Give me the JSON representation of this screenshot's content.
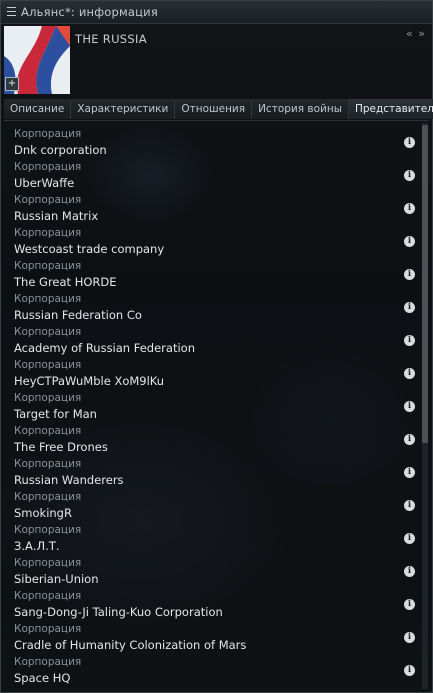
{
  "window": {
    "title": "Альянс*: информация",
    "collapse_glyph": "« »"
  },
  "alliance": {
    "name": "THE RUSSIA",
    "logo_icon": "alliance-flag-logo",
    "plus_glyph": "+"
  },
  "tabs": [
    {
      "label": "Описание",
      "active": false
    },
    {
      "label": "Характеристики",
      "active": false
    },
    {
      "label": "Отношения",
      "active": false
    },
    {
      "label": "История войны",
      "active": false
    },
    {
      "label": "Представители",
      "active": true
    }
  ],
  "members": [
    {
      "kind": "Корпорация",
      "name": "Dnk corporation",
      "info": "i"
    },
    {
      "kind": "Корпорация",
      "name": "UberWaffe",
      "info": "i"
    },
    {
      "kind": "Корпорация",
      "name": "Russian Matrix",
      "info": "i"
    },
    {
      "kind": "Корпорация",
      "name": "Westcoast trade company",
      "info": "i"
    },
    {
      "kind": "Корпорация",
      "name": "The Great HORDE",
      "info": "i"
    },
    {
      "kind": "Корпорация",
      "name": "Russian Federation Co",
      "info": "i"
    },
    {
      "kind": "Корпорация",
      "name": "Academy of Russian Federation",
      "info": "i"
    },
    {
      "kind": "Корпорация",
      "name": "HeyCTPaWuMble XoM9lKu",
      "info": "i"
    },
    {
      "kind": "Корпорация",
      "name": "Target for Man",
      "info": "i"
    },
    {
      "kind": "Корпорация",
      "name": "The Free Drones",
      "info": "i"
    },
    {
      "kind": "Корпорация",
      "name": "Russian Wanderers",
      "info": "i"
    },
    {
      "kind": "Корпорация",
      "name": "SmokingR",
      "info": "i"
    },
    {
      "kind": "Корпорация",
      "name": "З.А.Л.Т.",
      "info": "i"
    },
    {
      "kind": "Корпорация",
      "name": "Siberian-Union",
      "info": "i"
    },
    {
      "kind": "Корпорация",
      "name": "Sang-Dong-Ji Taling-Kuo Corporation",
      "info": "i"
    },
    {
      "kind": "Корпорация",
      "name": "Cradle of Humanity Colonization of Mars",
      "info": "i"
    },
    {
      "kind": "Корпорация",
      "name": "Space HQ",
      "info": "i"
    }
  ]
}
